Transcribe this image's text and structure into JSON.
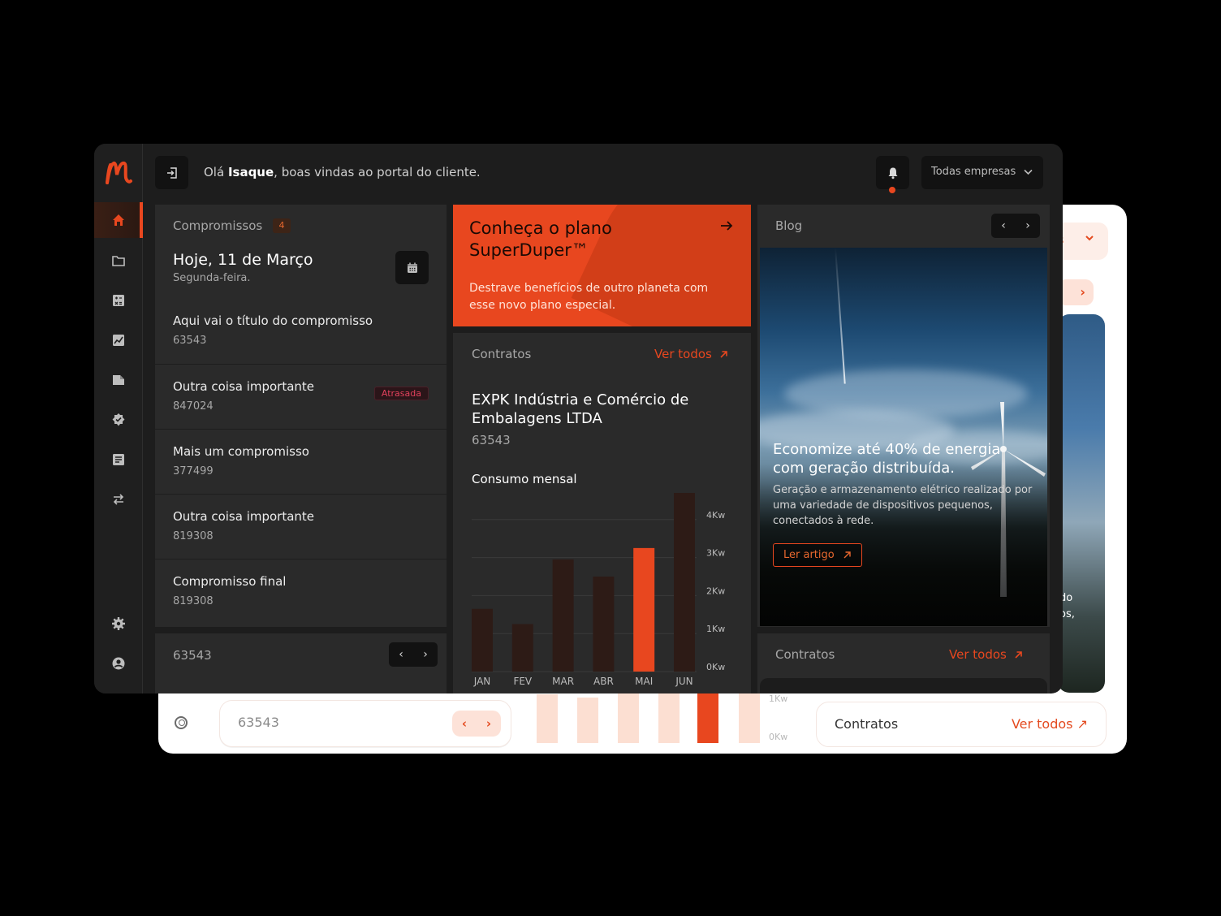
{
  "app": {
    "name": "Portal do cliente"
  },
  "header": {
    "greeting_prefix": "Olá ",
    "user_name": "Isaque",
    "greeting_suffix": ", boas vindas ao portal do cliente.",
    "company_select": "Todas empresas"
  },
  "sidebar": {
    "items": [
      {
        "icon": "home-icon",
        "active": true
      },
      {
        "icon": "folder-icon"
      },
      {
        "icon": "calculator-icon"
      },
      {
        "icon": "chart-icon"
      },
      {
        "icon": "document-icon"
      },
      {
        "icon": "verified-icon"
      },
      {
        "icon": "list-icon"
      },
      {
        "icon": "transfer-icon"
      },
      {
        "icon": "gear-icon"
      },
      {
        "icon": "user-icon"
      }
    ]
  },
  "compromissos": {
    "title": "Compromissos",
    "count": "4",
    "today": "Hoje, 11 de Março",
    "weekday": "Segunda-feira.",
    "items": [
      {
        "title": "Aqui vai o título do compromisso",
        "number": "63543"
      },
      {
        "title": "Outra coisa importante",
        "number": "847024",
        "tag": "Atrasada"
      },
      {
        "title": "Mais um compromisso",
        "number": "377499"
      },
      {
        "title": "Outra coisa importante",
        "number": "819308"
      },
      {
        "title": "Compromisso final",
        "number": "819308"
      }
    ],
    "footer_number": "63543"
  },
  "promo": {
    "title": "Conheça o plano SuperDuper™",
    "description": "Destrave benefícios de outro planeta com esse novo plano especial."
  },
  "contratos": {
    "title": "Contratos",
    "link": "Ver todos",
    "company": "EXPK Indústria e Comércio de Embalagens LTDA",
    "number": "63543",
    "chart_title": "Consumo mensal"
  },
  "chart_data": {
    "type": "bar",
    "title": "Consumo mensal",
    "categories": [
      "JAN",
      "FEV",
      "MAR",
      "ABR",
      "MAI",
      "JUN"
    ],
    "values": [
      1.65,
      1.25,
      2.95,
      2.5,
      3.25,
      4.7
    ],
    "highlight_index": 4,
    "ylim": [
      0,
      4.7
    ],
    "yticks": [
      "0Kw",
      "1Kw",
      "2Kw",
      "3Kw",
      "4Kw"
    ],
    "colors": {
      "bar": "#2d1b16",
      "highlight": "#e8471f",
      "grid": "#3a3a3a"
    }
  },
  "blog": {
    "title": "Blog",
    "headline": "Economize até 40% de energia com geração distribuída.",
    "description": "Geração e armazenamento elétrico realizado por uma variedade de dispositivos pequenos, conectados à rede.",
    "button": "Ler artigo"
  },
  "contratos2": {
    "title": "Contratos",
    "link": "Ver todos"
  },
  "light_window": {
    "number": "63543",
    "contratos_title": "Contratos",
    "contratos_link": "Ver todos",
    "tick_1": "1Kw",
    "tick_0": "0Kw",
    "partial_top": "s",
    "partial_1": "do",
    "partial_2": "os,"
  },
  "colors": {
    "accent": "#e8471f",
    "bg": "#1d1d1d",
    "panel": "#2a2a2a"
  }
}
